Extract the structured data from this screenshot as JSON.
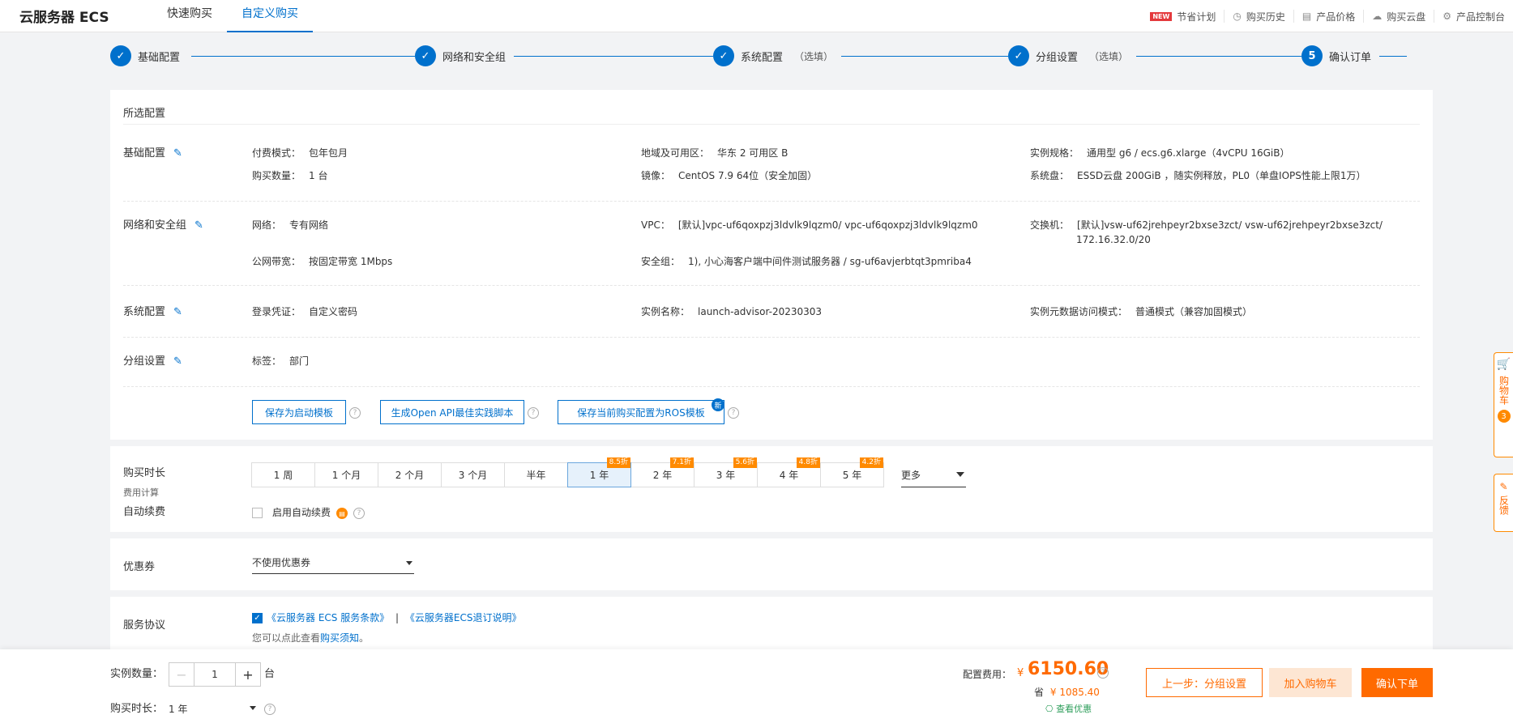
{
  "header": {
    "brand": "云服务器 ECS",
    "tabs": [
      "快速购买",
      "自定义购买"
    ],
    "links": [
      {
        "label": "节省计划",
        "icon": "new-badge",
        "badge": "NEW"
      },
      {
        "label": "购买历史",
        "icon": "clock-icon"
      },
      {
        "label": "产品价格",
        "icon": "document-icon"
      },
      {
        "label": "购买云盘",
        "icon": "cloud-icon"
      },
      {
        "label": "产品控制台",
        "icon": "gear-icon"
      }
    ]
  },
  "steps": [
    {
      "label": "基础配置",
      "state": "done",
      "optional": ""
    },
    {
      "label": "网络和安全组",
      "state": "done",
      "optional": ""
    },
    {
      "label": "系统配置",
      "state": "done",
      "optional": "（选填）"
    },
    {
      "label": "分组设置",
      "state": "done",
      "optional": "（选填）"
    },
    {
      "label": "确认订单",
      "state": "current",
      "number": "5",
      "optional": ""
    }
  ],
  "summary": {
    "title": "所选配置",
    "basic": {
      "title": "基础配置",
      "billing_k": "付费模式：",
      "billing_v": "包年包月",
      "region_k": "地域及可用区：",
      "region_v": "华东 2 可用区 B",
      "spec_k": "实例规格：",
      "spec_v": "通用型 g6 / ecs.g6.xlarge（4vCPU 16GiB）",
      "qty_k": "购买数量：",
      "qty_v": "1 台",
      "image_k": "镜像：",
      "image_v": "CentOS 7.9 64位（安全加固）",
      "disk_k": "系统盘：",
      "disk_v": "ESSD云盘 200GiB ，随实例释放，PL0（单盘IOPS性能上限1万）"
    },
    "network": {
      "title": "网络和安全组",
      "net_k": "网络：",
      "net_v": "专有网络",
      "vpc_k": "VPC：",
      "vpc_v": "[默认]vpc-uf6qoxpzj3ldvlk9lqzm0/ vpc-uf6qoxpzj3ldvlk9lqzm0",
      "vsw_k": "交换机：",
      "vsw_v": "[默认]vsw-uf62jrehpeyr2bxse3zct/ vsw-uf62jrehpeyr2bxse3zct/",
      "vsw_v2": "172.16.32.0/20",
      "bw_k": "公网带宽：",
      "bw_v": "按固定带宽 1Mbps",
      "sg_k": "安全组：",
      "sg_v": "1), 小心海客户端中间件测试服务器 / sg-uf6avjerbtqt3pmriba4"
    },
    "system": {
      "title": "系统配置",
      "login_k": "登录凭证：",
      "login_v": "自定义密码",
      "name_k": "实例名称：",
      "name_v": "launch-advisor-20230303",
      "meta_k": "实例元数据访问模式：",
      "meta_v": "普通模式（兼容加固模式）"
    },
    "group": {
      "title": "分组设置",
      "tag_k": "标签：",
      "tag_v": "部门"
    },
    "buttons": {
      "save_template": "保存为启动模板",
      "openapi": "生成Open API最佳实践脚本",
      "ros": "保存当前购买配置为ROS模板",
      "ros_badge": "新"
    }
  },
  "duration": {
    "title": "购买时长",
    "subtitle": "费用计算",
    "options": [
      {
        "label": "1 周",
        "discount": ""
      },
      {
        "label": "1 个月",
        "discount": ""
      },
      {
        "label": "2 个月",
        "discount": ""
      },
      {
        "label": "3 个月",
        "discount": ""
      },
      {
        "label": "半年",
        "discount": ""
      },
      {
        "label": "1 年",
        "discount": "8.5折"
      },
      {
        "label": "2 年",
        "discount": "7.1折"
      },
      {
        "label": "3 年",
        "discount": "5.6折"
      },
      {
        "label": "4 年",
        "discount": "4.8折"
      },
      {
        "label": "5 年",
        "discount": "4.2折"
      }
    ],
    "selected_index": 5,
    "more": "更多",
    "auto_renew_title": "自动续费",
    "auto_renew_label": "启用自动续费",
    "auto_renew_checked": false
  },
  "coupon": {
    "title": "优惠券",
    "value": "不使用优惠券"
  },
  "agreement": {
    "title": "服务协议",
    "checked": true,
    "link1": "《云服务器 ECS 服务条款》",
    "sep": "|",
    "link2": "《云服务器ECS退订说明》",
    "note_pre": "您可以点此查看",
    "note_link": "购买须知",
    "note_post": "。"
  },
  "footer": {
    "qty_label": "实例数量：",
    "qty_value": "1",
    "qty_unit": "台",
    "dur_label": "购买时长：",
    "dur_value": "1 年",
    "fee_label": "配置费用：",
    "currency": "¥",
    "price": "6150.60",
    "save_prefix": "省",
    "save_currency": "¥",
    "save_value": "1085.40",
    "discount_link": "查看优惠",
    "btn_prev": "上一步：分组设置",
    "btn_cart": "加入购物车",
    "btn_order": "确认下单"
  },
  "side_float": {
    "cart_text": "购物车",
    "cart_count": "3",
    "feedback_text": "反馈"
  },
  "colors": {
    "primary": "#0070cc",
    "orange": "#ff6a00"
  }
}
